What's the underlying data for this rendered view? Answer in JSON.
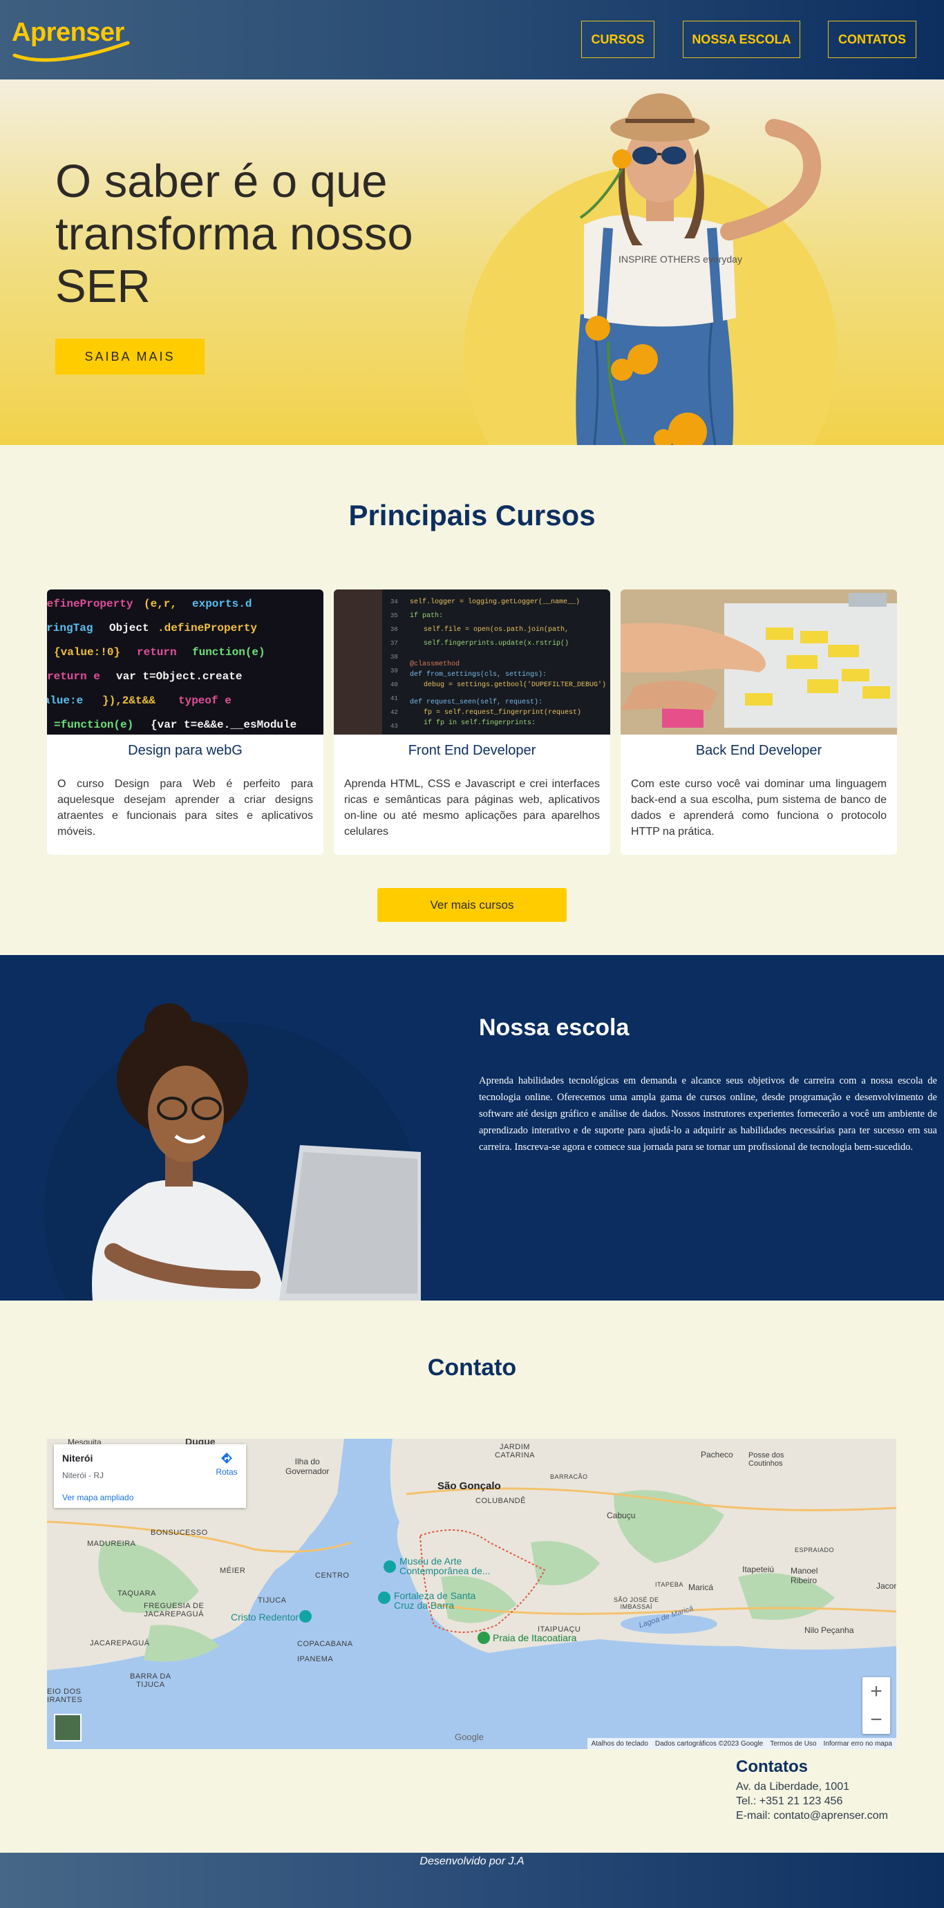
{
  "brand": {
    "logo_text": "Aprenser",
    "accent": "#ffc800",
    "navy": "#0d2f60"
  },
  "nav": [
    {
      "label": "CURSOS"
    },
    {
      "label": "NOSSA ESCOLA"
    },
    {
      "label": "CONTATOS"
    }
  ],
  "hero": {
    "title": "O saber é o que transforma nosso SER",
    "cta_label": "SAIBA MAIS",
    "shirt_text": "INSPIRE OTHERS everyday"
  },
  "courses": {
    "heading": "Principais Cursos",
    "items": [
      {
        "title": "Design para webG",
        "text": "O curso Design para Web é perfeito para aquelesque desejam aprender a criar designs atraentes e funcionais para sites e aplicativos móveis."
      },
      {
        "title": "Front End Developer",
        "text": "Aprenda HTML, CSS e Javascript e crei interfaces ricas e semânticas para páginas web, aplicativos on-line ou até mesmo aplicações para aparelhos celulares"
      },
      {
        "title": "Back End Developer",
        "text": "Com este curso você vai dominar uma linguagem back-end a sua escolha, pum sistema de banco de dados e aprenderá como funciona o protocolo HTTP na prática."
      }
    ],
    "more_label": "Ver mais cursos"
  },
  "school": {
    "heading": "Nossa escola",
    "text": "Aprenda habilidades tecnológicas em demanda e alcance seus objetivos de carreira com a nossa escola de tecnologia online. Oferecemos uma ampla gama de cursos online, desde programação e desenvolvimento de software até design gráfico e análise de dados. Nossos instrutores experientes fornecerão a você um ambiente de aprendizado interativo e de suporte para ajudá-lo a adquirir as habilidades necessárias para ter sucesso em sua carreira. Inscreva-se agora e comece sua jornada para se tornar um profissional de tecnologia bem-sucedido."
  },
  "contact": {
    "heading": "Contato",
    "map": {
      "place_name": "Niterói",
      "place_region": "Niterói - RJ",
      "bigger_map_label": "Ver mapa ampliado",
      "directions_label": "Rotas",
      "zoom_in": "+",
      "zoom_out": "−",
      "google_label": "Google",
      "footer": [
        "Atalhos do teclado",
        "Dados cartográficos ©2023 Google",
        "Termos de Uso",
        "Informar erro no mapa"
      ],
      "labels": {
        "sao_goncalo": "São Gonçalo",
        "jardim_catarina": "JARDIM\nCATARINA",
        "colubande": "COLUBANDÊ",
        "madureira": "MADUREIRA",
        "bonsucesso": "BONSUCESSO",
        "meier": "MÉIER",
        "centro": "CENTRO",
        "taquara": "TAQUARA",
        "freguesia": "FREGUESIA DE\nJACAREPAGUÁ",
        "tijuca": "TIJUCA",
        "jacarepagua": "JACAREPAGUÁ",
        "copacabana": "COPACABANA",
        "ipanema": "IPANEMA",
        "barra": "BARRA DA\nTIJUCA",
        "itaipuacu": "ITAIPUAÇU",
        "cabucu": "Cabuçu",
        "pacheco": "Pacheco",
        "posse": "Posse dos\nCoutinhos",
        "marica": "Maricá",
        "itapeteiu": "Itapeteiú",
        "manoel_ribeiro": "Manoel\nRibeiro",
        "nilo": "Nilo Peçanha",
        "ilha": "Ilha do\nGovernador",
        "mesquita": "Mesquita",
        "duque": "Duque",
        "barracao": "BARRACÃO",
        "espraiado": "ESPRAIADO",
        "itapeba": "ITAPEBA",
        "sao_jose": "SÃO JOSÉ DE\nIMBASSAÍ",
        "lagoa": "Lagoa de Maricá",
        "museu": "Museu de Arte\nContemporânea de...",
        "fortaleza": "Fortaleza de Santa\nCruz da Barra",
        "cristo": "Cristo Redentor",
        "itacoatiara": "Praia de Itacoatiara",
        "jacone": "Jacone",
        "reio": "EIO DOS\nIRANTES"
      }
    },
    "details_heading": "Contatos",
    "address": "Av. da Liberdade, 1001",
    "phone": "Tel.: +351 21 123 456",
    "email": "E-mail: contato@aprenser.com"
  },
  "footer": {
    "text": "Desenvolvido por J.A"
  }
}
